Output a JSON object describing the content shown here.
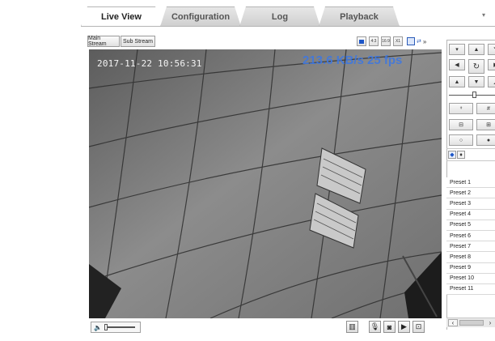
{
  "tabs": [
    {
      "label": "Live View",
      "active": true
    },
    {
      "label": "Configuration",
      "active": false
    },
    {
      "label": "Log",
      "active": false
    },
    {
      "label": "Playback",
      "active": false
    }
  ],
  "toolbar": {
    "main_stream_label": "Main Stream",
    "sub_stream_label": "Sub Stream",
    "ratio_buttons": [
      "4:3",
      "16:9",
      "X1"
    ]
  },
  "video": {
    "osd_timestamp": "2017-11-22 10:56:31",
    "osd_bitrate": "213.6 KB/s 25 fps"
  },
  "ptz": {
    "presets": [
      "Preset 1",
      "Preset 2",
      "Preset 3",
      "Preset 4",
      "Preset 5",
      "Preset 6",
      "Preset 7",
      "Preset 8",
      "Preset 9",
      "Preset 10",
      "Preset 11"
    ]
  },
  "colors": {
    "bitrate_text": "#3f78e0",
    "active_tab": "#ffffff",
    "inactive_tab": "#d6d6d6"
  }
}
